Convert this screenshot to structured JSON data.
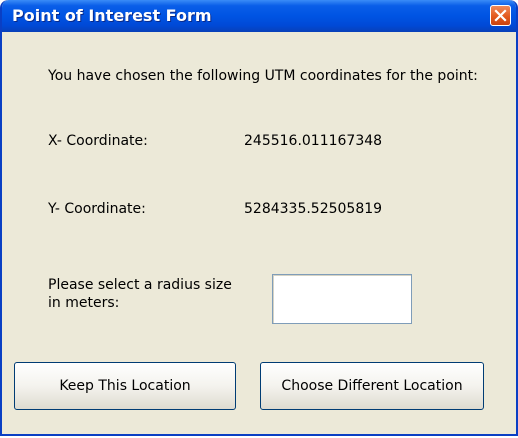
{
  "window": {
    "title": "Point of Interest Form"
  },
  "form": {
    "intro_text": "You have chosen the following UTM coordinates for the point:",
    "x_label": "X- Coordinate:",
    "x_value": "245516.011167348",
    "y_label": "Y- Coordinate:",
    "y_value": "5284335.52505819",
    "radius_label": "Please select a radius size in meters:",
    "radius_value": ""
  },
  "buttons": {
    "keep_label": "Keep This Location",
    "choose_label": "Choose Different Location"
  },
  "icons": {
    "close": "close-icon"
  },
  "colors": {
    "titlebar": "#0054e3",
    "close_button": "#e35a1e",
    "dialog_background": "#ece9d8"
  }
}
